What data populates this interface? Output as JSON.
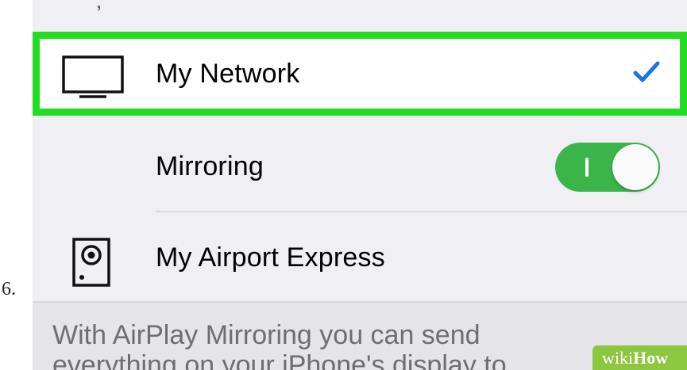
{
  "step": {
    "number": "6."
  },
  "top": {
    "fragment": ","
  },
  "airplay": {
    "devices": [
      {
        "label": "My Network",
        "icon": "tv-icon",
        "selected": true,
        "highlight_color": "#22dd22",
        "check_color": "#1a73e8"
      },
      {
        "label": "My Airport Express",
        "icon": "speaker-icon",
        "selected": false
      }
    ],
    "mirroring": {
      "label": "Mirroring",
      "enabled": true,
      "toggle_color": "#3bb54a"
    }
  },
  "footer": {
    "text": "With AirPlay Mirroring you can send everything on your iPhone's display to"
  },
  "watermark": {
    "wiki": "wiki",
    "how": "How"
  }
}
